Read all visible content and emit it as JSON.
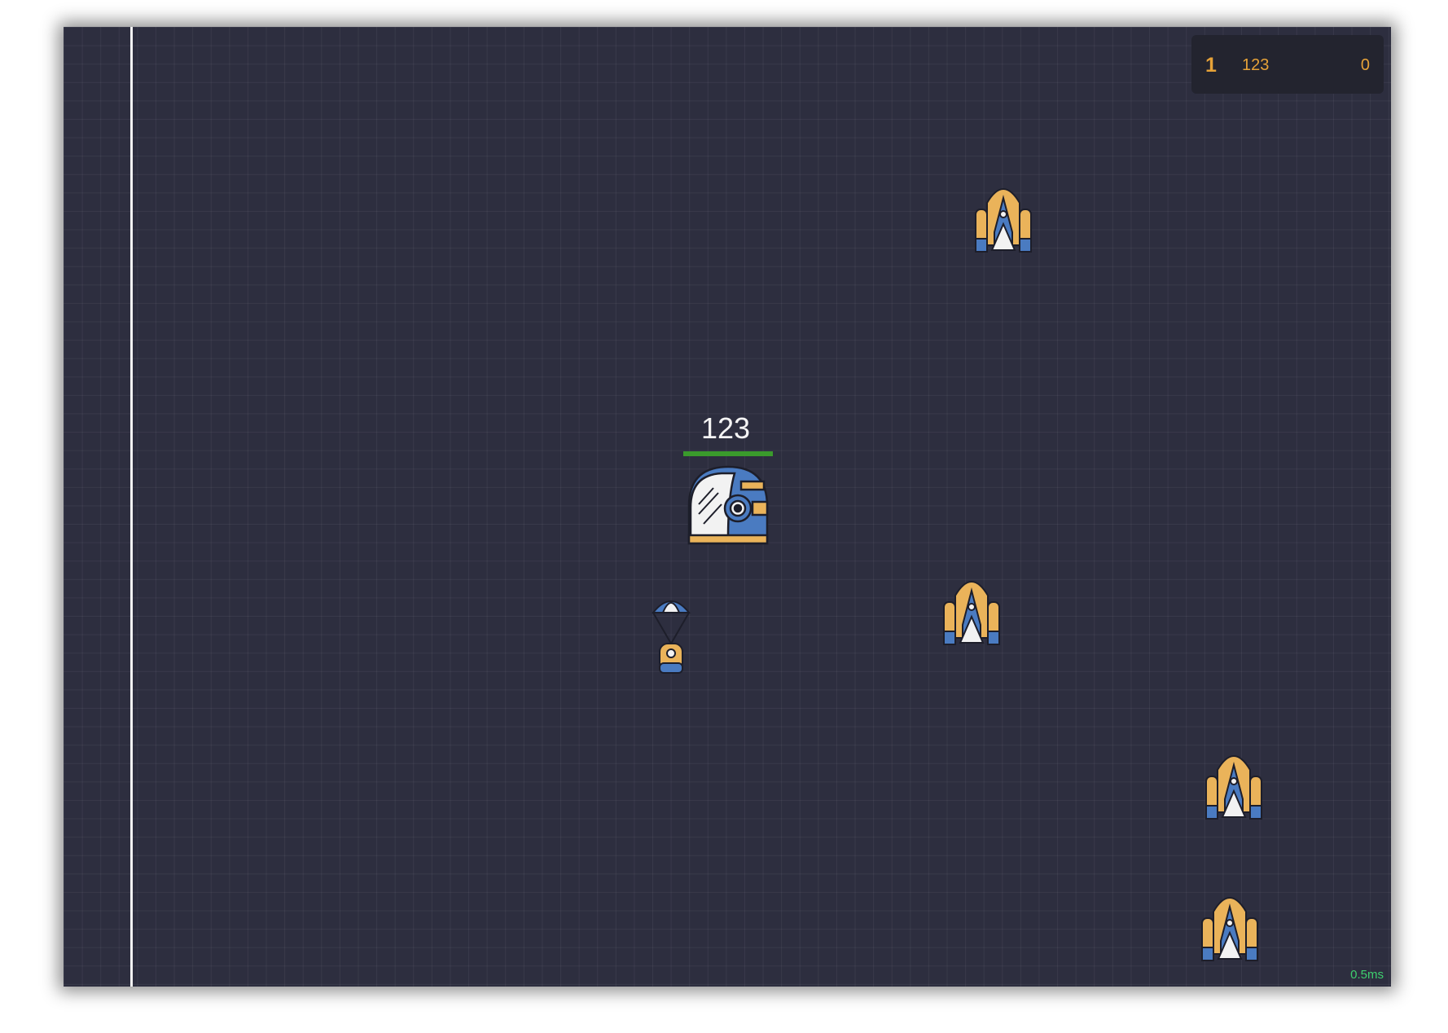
{
  "leaderboard": {
    "entries": [
      {
        "rank": "1",
        "name": "123",
        "score": "0"
      }
    ]
  },
  "player": {
    "name": "123",
    "health_fraction": 1.0
  },
  "perf": {
    "frame_time": "0.5ms"
  },
  "colors": {
    "background": "#2d2e3f",
    "accent": "#e6a238",
    "health": "#3a9b2c",
    "fps_text": "#3ecf6e",
    "boundary": "#f3f3f3"
  },
  "entities": {
    "player_icon": "astronaut-helmet-icon",
    "item_icon": "parachute-supply-icon",
    "enemy_icon": "space-shuttle-icon"
  }
}
